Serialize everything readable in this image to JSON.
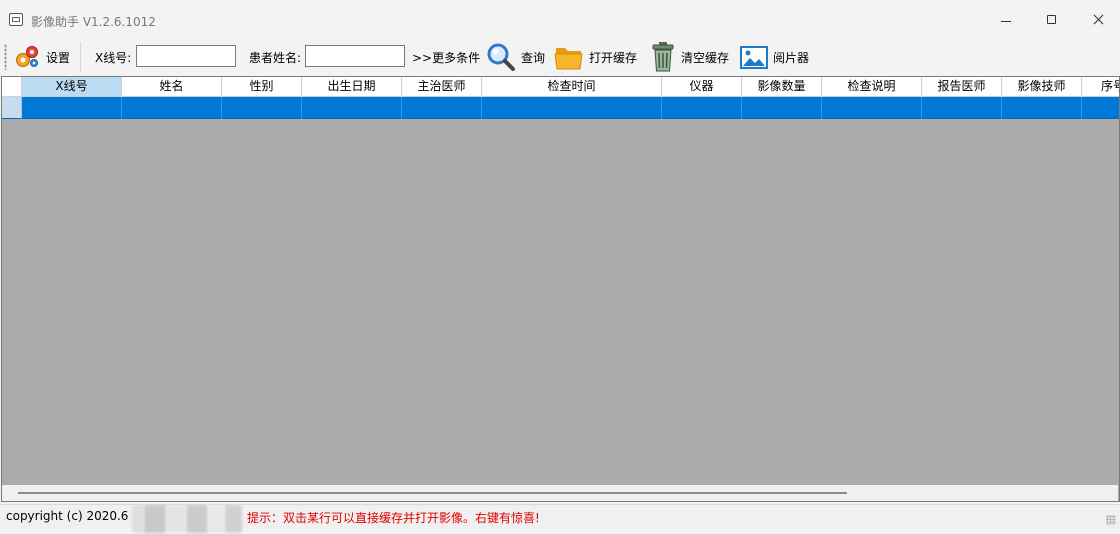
{
  "window": {
    "title": "影像助手 V1.2.6.1012"
  },
  "toolbar": {
    "settings_label": "设置",
    "xray_label": "X线号:",
    "xray_value": "",
    "patient_label": "患者姓名:",
    "patient_value": "",
    "more_conditions_label": ">>更多条件",
    "search_label": "查询",
    "open_cache_label": "打开缓存",
    "clear_cache_label": "清空缓存",
    "viewer_label": "阅片器"
  },
  "grid": {
    "columns": [
      "X线号",
      "姓名",
      "性别",
      "出生日期",
      "主治医师",
      "检查时间",
      "仪器",
      "影像数量",
      "检查说明",
      "报告医师",
      "影像技师",
      "序号"
    ],
    "selected_column": "X线号",
    "rows": [
      [
        "",
        "",
        "",
        "",
        "",
        "",
        "",
        "",
        "",
        "",
        "",
        ""
      ]
    ]
  },
  "status": {
    "copyright": "copyright (c)  2020.6",
    "hint": "提示：双击某行可以直接缓存并打开影像。右键有惊喜!"
  },
  "colors": {
    "selection": "#0078d7",
    "grid_background": "#ababab",
    "hint_text": "#e00000",
    "selected_header": "#bcdcf4"
  }
}
